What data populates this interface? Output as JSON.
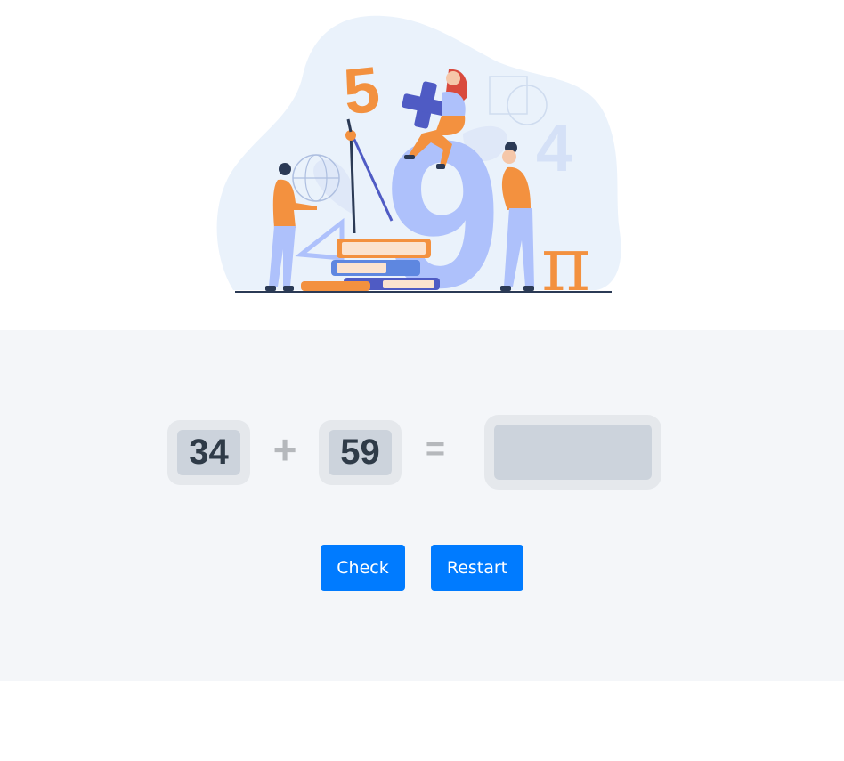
{
  "illustration": {
    "glyph_five": "5",
    "glyph_plus": "+",
    "glyph_nine": "9",
    "glyph_four": "4",
    "glyph_pi": "π",
    "colors": {
      "blob": "#eaf2fb",
      "orange": "#f3913f",
      "periwinkle": "#aec1fb",
      "indigo": "#4f5bc4",
      "navy": "#2b3a55"
    }
  },
  "equation": {
    "operand_a": "34",
    "operator": "+",
    "operand_b": "59",
    "equals": "=",
    "answer_value": "",
    "answer_placeholder": ""
  },
  "buttons": {
    "check_label": "Check",
    "restart_label": "Restart"
  },
  "colors": {
    "accent": "#007bff",
    "panel_bg": "#f4f6f9",
    "chip_outer": "#e5e8ec",
    "chip_inner": "#ccd3dc",
    "digit_text": "#2f3b48"
  }
}
